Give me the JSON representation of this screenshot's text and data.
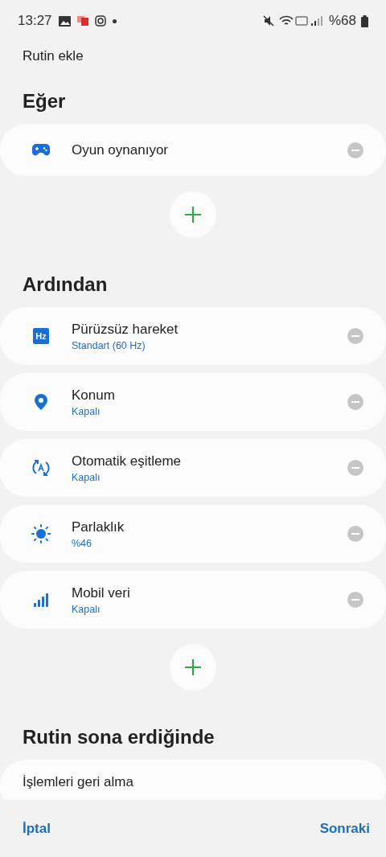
{
  "status_bar": {
    "time": "13:27",
    "battery": "%68"
  },
  "header": {
    "title": "Rutin ekle"
  },
  "sections": [
    {
      "title": "Eğer",
      "items": [
        {
          "kind": "gamepad",
          "label": "Oyun oynanıyor"
        }
      ],
      "add_button": true
    },
    {
      "title": "Ardından",
      "items": [
        {
          "kind": "hz",
          "label": "Pürüzsüz hareket",
          "value": "Standart (60 Hz)",
          "badge": "Hz"
        },
        {
          "kind": "location",
          "label": "Konum",
          "value": "Kapalı"
        },
        {
          "kind": "sync",
          "label": "Otomatik eşitleme",
          "value": "Kapalı"
        },
        {
          "kind": "brightness",
          "label": "Parlaklık",
          "value": "%46"
        },
        {
          "kind": "signal",
          "label": "Mobil veri",
          "value": "Kapalı"
        }
      ],
      "add_button": true
    },
    {
      "title": "Rutin sona erdiğinde",
      "items": [
        {
          "kind": "plain",
          "label": "İşlemleri geri alma"
        }
      ],
      "add_button": false
    }
  ],
  "footer": {
    "cancel": "İptal",
    "next": "Sonraki"
  }
}
